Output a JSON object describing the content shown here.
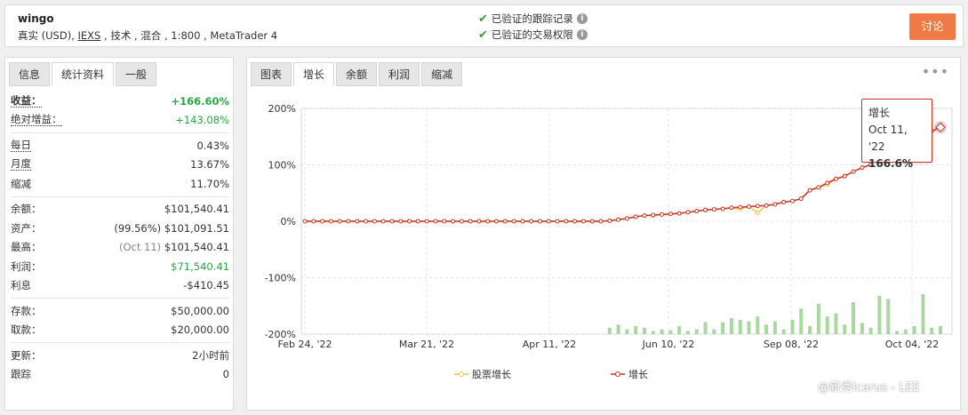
{
  "header": {
    "account_name": "wingo",
    "info_prefix": "真实 (USD), ",
    "info_link": "IEXS",
    "info_suffix": " , 技术 , 混合 , 1:800 , MetaTrader 4",
    "verified_1": "已验证的跟踪记录",
    "verified_2": "已验证的交易权限",
    "discuss_label": "讨论"
  },
  "left_tabs": [
    "信息",
    "统计资料",
    "一般"
  ],
  "stats": {
    "gain_label": "收益：",
    "gain_value": "+166.60%",
    "abs_gain_label": "绝对增益：",
    "abs_gain_value": "+143.08%",
    "daily_label": "每日",
    "daily_value": "0.43%",
    "monthly_label": "月度",
    "monthly_value": "13.67%",
    "drawdown_label": "缩减",
    "drawdown_value": "11.70%",
    "balance_label": "余额：",
    "balance_value": "$101,540.41",
    "equity_label": "资产：",
    "equity_pct": "(99.56%)",
    "equity_value": "$101,091.51",
    "highest_label": "最高：",
    "highest_date": "(Oct 11)",
    "highest_value": "$101,540.41",
    "profit_label": "利润：",
    "profit_value": "$71,540.41",
    "interest_label": "利息",
    "interest_value": "-$410.45",
    "deposits_label": "存款：",
    "deposits_value": "$50,000.00",
    "withdrawals_label": "取款：",
    "withdrawals_value": "$20,000.00",
    "updated_label": "更新：",
    "updated_value": "2小时前",
    "tracking_label": "跟踪",
    "tracking_value": "0"
  },
  "right_tabs": [
    "图表",
    "增长",
    "余额",
    "利润",
    "缩减"
  ],
  "tooltip": {
    "title": "增长",
    "date": "Oct 11, '22",
    "value": "166.6%"
  },
  "watermark": "@新秀Icarus - LEE",
  "colors": {
    "growth": "#c0392b",
    "equity_growth": "#f5c242",
    "bars": "#a8d8a0",
    "button": "#ef7a45"
  },
  "chart_data": {
    "type": "line",
    "ylim": [
      -200,
      200
    ],
    "y_ticks": [
      "200%",
      "100%",
      "0%",
      "-100%",
      "-200%"
    ],
    "x_ticks": [
      "Feb 24, '22",
      "Mar 21, '22",
      "Apr 11, '22",
      "Jun 10, '22",
      "Sep 08, '22",
      "Oct 04, '22"
    ],
    "legend": [
      "股票增长",
      "增长"
    ],
    "series": [
      {
        "name": "增长",
        "values": [
          0,
          0,
          0,
          0,
          0,
          0,
          0,
          0,
          0,
          0,
          0,
          0,
          0,
          0,
          0,
          0,
          0,
          0,
          0,
          0,
          0,
          0,
          0,
          0,
          0,
          0,
          0,
          0,
          0,
          0,
          0,
          0,
          0,
          0,
          0,
          1,
          3,
          5,
          8,
          10,
          11,
          12,
          13,
          14,
          16,
          18,
          20,
          21,
          22,
          24,
          25,
          26,
          27,
          28,
          30,
          34,
          36,
          40,
          55,
          60,
          68,
          75,
          80,
          88,
          95,
          100,
          120,
          130,
          135,
          145,
          150,
          155,
          160,
          166.6
        ]
      },
      {
        "name": "股票增长",
        "values": [
          0,
          0,
          0,
          0,
          0,
          0,
          0,
          0,
          0,
          0,
          0,
          0,
          0,
          0,
          0,
          0,
          0,
          0,
          0,
          0,
          0,
          0,
          0,
          0,
          0,
          0,
          0,
          0,
          0,
          0,
          0,
          0,
          0,
          0,
          0,
          1,
          3,
          5,
          8,
          10,
          10,
          12,
          13,
          14,
          16,
          18,
          20,
          21,
          22,
          24,
          22,
          26,
          15,
          28,
          30,
          34,
          36,
          40,
          55,
          60,
          65,
          75,
          80,
          88,
          95,
          100,
          120,
          130,
          135,
          145,
          150,
          155,
          160,
          166.6
        ]
      }
    ],
    "bars": [
      0,
      0,
      0,
      0,
      0,
      0,
      0,
      0,
      0,
      0,
      0,
      0,
      0,
      0,
      0,
      0,
      0,
      0,
      0,
      0,
      0,
      0,
      0,
      0,
      0,
      0,
      0,
      0,
      0,
      0,
      0,
      0,
      0,
      0,
      0,
      8,
      12,
      6,
      10,
      8,
      4,
      6,
      5,
      10,
      4,
      6,
      15,
      6,
      15,
      20,
      18,
      16,
      22,
      12,
      16,
      6,
      18,
      32,
      10,
      38,
      22,
      26,
      12,
      40,
      14,
      8,
      48,
      44,
      4,
      6,
      10,
      50,
      8,
      10
    ]
  }
}
